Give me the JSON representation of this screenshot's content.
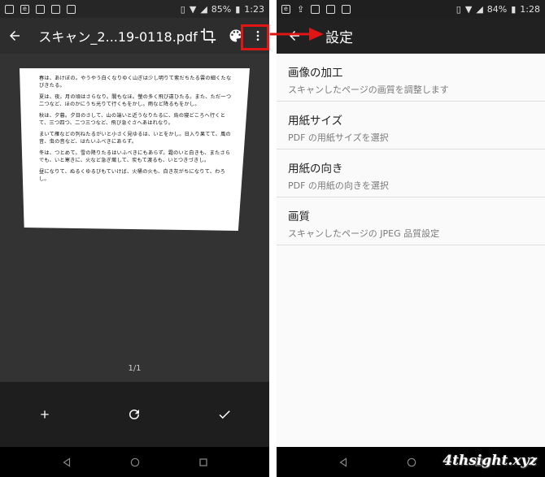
{
  "left_screen": {
    "status": {
      "battery": "85%",
      "time": "1:23"
    },
    "title": "スキャン_2...19-0118.pdf",
    "document_lines": [
      "春は、あけぼの。やうやう白くなりゆく山ぎは少し明りて紫だちたる雲の細くたなびきたる。",
      "夏は、夜。月の頃はさらなり。闇もなほ。螢の多く飛び違ひたる。また、ただ一つ二つなど、ほのかにうち光りて行くもをかし。雨など降るもをかし。",
      "秋は、夕暮。夕日のさして、山の端いと近うなりたるに、烏の寝どころへ行くとて、三つ四つ、二つ三つなど、飛び急ぐさへあはれなり。",
      "まいて雁などの列ねたるがいと小さく見ゆるは、いとをかし。日入り果てて、風の音、虫の音など、はたいふべきにあらず。",
      "冬は、つとめて。雪の降りたるはいふべきにもあらず。霜のいと白きも、またさらでも、いと寒きに、火など急ぎ熾して、炭もて渡るも、いとつきづきし。",
      "昼になりて、ぬるくゆるびもていけば、火桶の火も、白き灰がちになりて、わろし。"
    ],
    "pager": "1/1"
  },
  "right_screen": {
    "status": {
      "battery": "84%",
      "time": "1:28"
    },
    "title": "設定",
    "items": [
      {
        "title": "画像の加工",
        "subtitle": "スキャンしたページの画質を調整します"
      },
      {
        "title": "用紙サイズ",
        "subtitle": "PDF の用紙サイズを選択"
      },
      {
        "title": "用紙の向き",
        "subtitle": "PDF の用紙の向きを選択"
      },
      {
        "title": "画質",
        "subtitle": "スキャンしたページの JPEG 品質設定"
      }
    ]
  },
  "watermark": "4thsight.xyz",
  "colors": {
    "highlight": "#e01515",
    "dark_bg": "#2d2d2d",
    "toolbar_dark": "#212121"
  }
}
